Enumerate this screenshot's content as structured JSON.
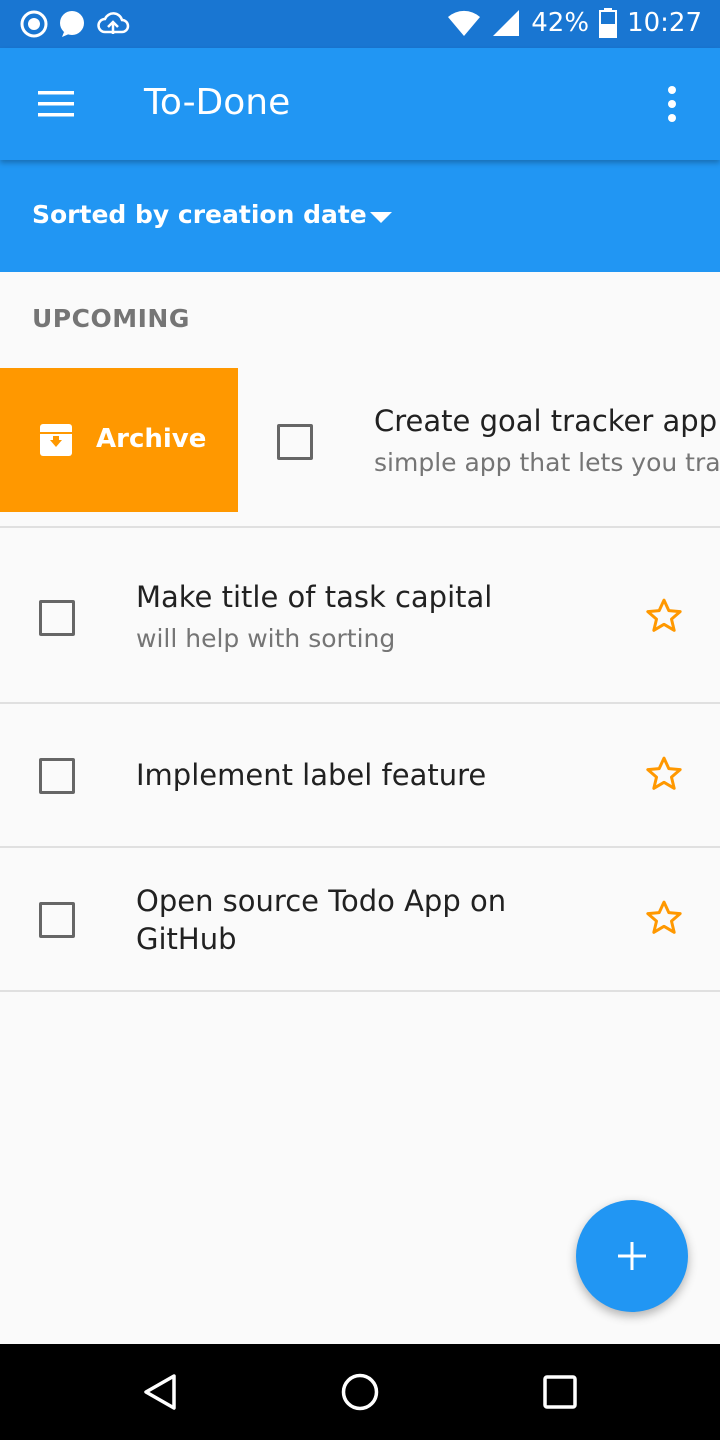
{
  "status_bar": {
    "battery": "42%",
    "time": "10:27",
    "icons": [
      "record-icon",
      "chat-icon",
      "cloud-upload-icon",
      "wifi-icon",
      "signal-icon",
      "battery-icon"
    ]
  },
  "app_bar": {
    "title": "To-Done",
    "menu_icon": "hamburger-menu-icon",
    "more_icon": "more-vert-icon"
  },
  "sort": {
    "label": "Sorted by creation date"
  },
  "section": {
    "header": "UPCOMING"
  },
  "swipe_action": {
    "label": "Archive",
    "color": "#ff9800"
  },
  "tasks": [
    {
      "title": "Create goal tracker app",
      "subtitle": "simple app that lets you trac",
      "starred": false
    },
    {
      "title": "Make title of task capital",
      "subtitle": "will help with sorting",
      "starred": false
    },
    {
      "title": "Implement label feature",
      "subtitle": "",
      "starred": false
    },
    {
      "title_line1": "Open source Todo App on",
      "title_line2": "GitHub",
      "subtitle": "",
      "starred": false
    }
  ],
  "colors": {
    "primary": "#2196f3",
    "primary_dark": "#1976d2",
    "accent_star": "#ff9800"
  },
  "fab": {
    "icon": "add-icon"
  },
  "nav": {
    "icons": [
      "back-icon",
      "home-icon",
      "recents-icon"
    ]
  }
}
